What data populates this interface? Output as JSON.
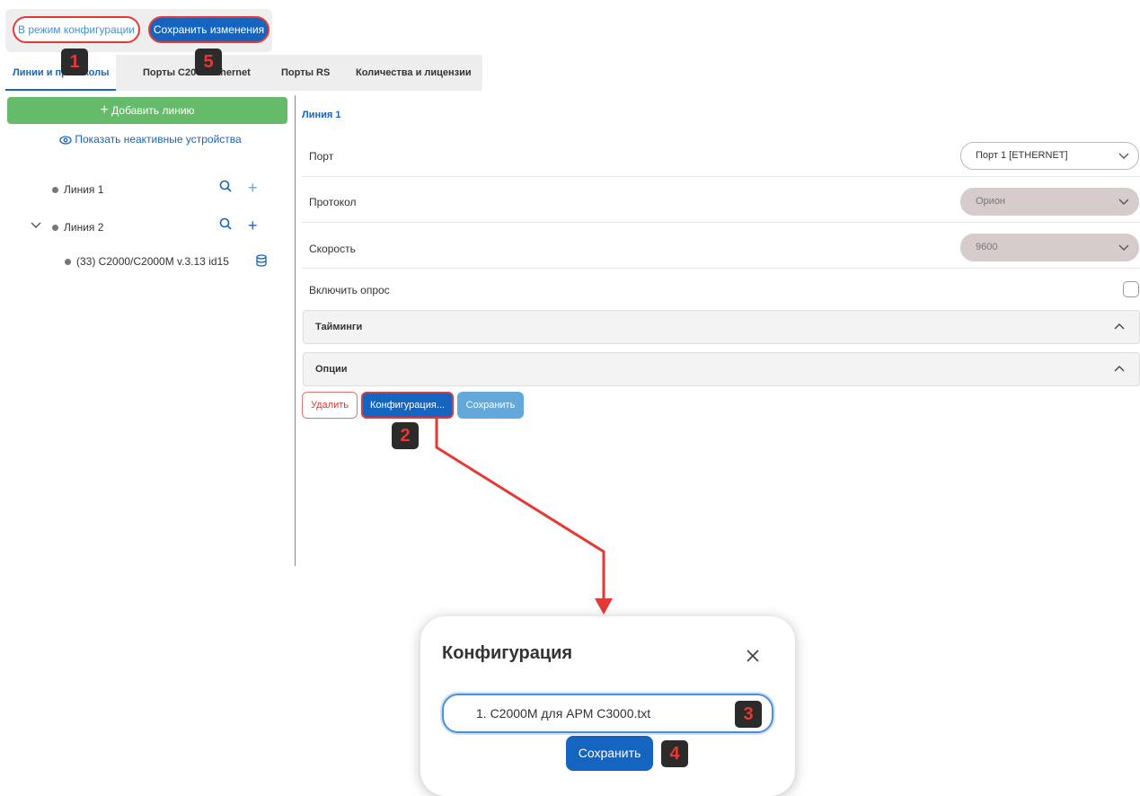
{
  "toolbar": {
    "config_mode_label": "В режим конфигурации",
    "save_changes_label": "Сохранить изменения"
  },
  "tabs": [
    {
      "label": "Линии и протоколы",
      "active": true
    },
    {
      "label": "Порты С2000-Ethernet",
      "active": false
    },
    {
      "label": "Порты RS",
      "active": false
    },
    {
      "label": "Количества и лицензии",
      "active": false
    }
  ],
  "left_panel": {
    "add_line_label": "Добавить линию",
    "show_inactive_label": "Показать неактивные устройства",
    "tree": [
      {
        "label": "Линия 1"
      },
      {
        "label": "Линия 2"
      },
      {
        "label": "(33) С2000/С2000М v.3.13 id15"
      }
    ]
  },
  "right_panel": {
    "title": "Линия 1",
    "port": {
      "label": "Порт",
      "value": "Порт 1 [ETHERNET]"
    },
    "protocol": {
      "label": "Протокол",
      "value": "Орион"
    },
    "speed": {
      "label": "Скорость",
      "value": "9600"
    },
    "enable_polling": {
      "label": "Включить опрос",
      "checked": false
    },
    "accordions": [
      {
        "label": "Тайминги"
      },
      {
        "label": "Опции"
      }
    ],
    "buttons": {
      "delete": "Удалить",
      "configuration": "Конфигурация...",
      "save": "Сохранить"
    }
  },
  "badges": {
    "b1": "1",
    "b2": "2",
    "b3": "3",
    "b4": "4",
    "b5": "5"
  },
  "modal": {
    "title": "Конфигурация",
    "file_value": "1. С2000М для АРМ С3000.txt",
    "save_label": "Сохранить"
  },
  "colors": {
    "primary": "#1565c0",
    "accent_red": "#e53935",
    "green": "#66bb6a"
  }
}
